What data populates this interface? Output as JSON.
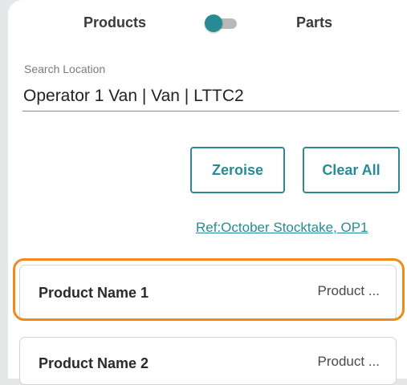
{
  "toggle": {
    "left_label": "Products",
    "right_label": "Parts",
    "state": "products",
    "accent_color": "#2a8a93"
  },
  "search": {
    "label": "Search Location",
    "value": "Operator 1 Van | Van | LTTC2"
  },
  "actions": {
    "zeroise_label": "Zeroise",
    "clear_all_label": "Clear All"
  },
  "reference": {
    "text": "Ref:October Stocktake, OP1"
  },
  "products": [
    {
      "name": "Product Name 1",
      "code": "Product ...",
      "selected": true
    },
    {
      "name": "Product Name 2",
      "code": "Product ...",
      "selected": false
    }
  ],
  "colors": {
    "accent": "#2a8a93",
    "selection": "#f28a1b",
    "background": "#e6e7e9"
  }
}
